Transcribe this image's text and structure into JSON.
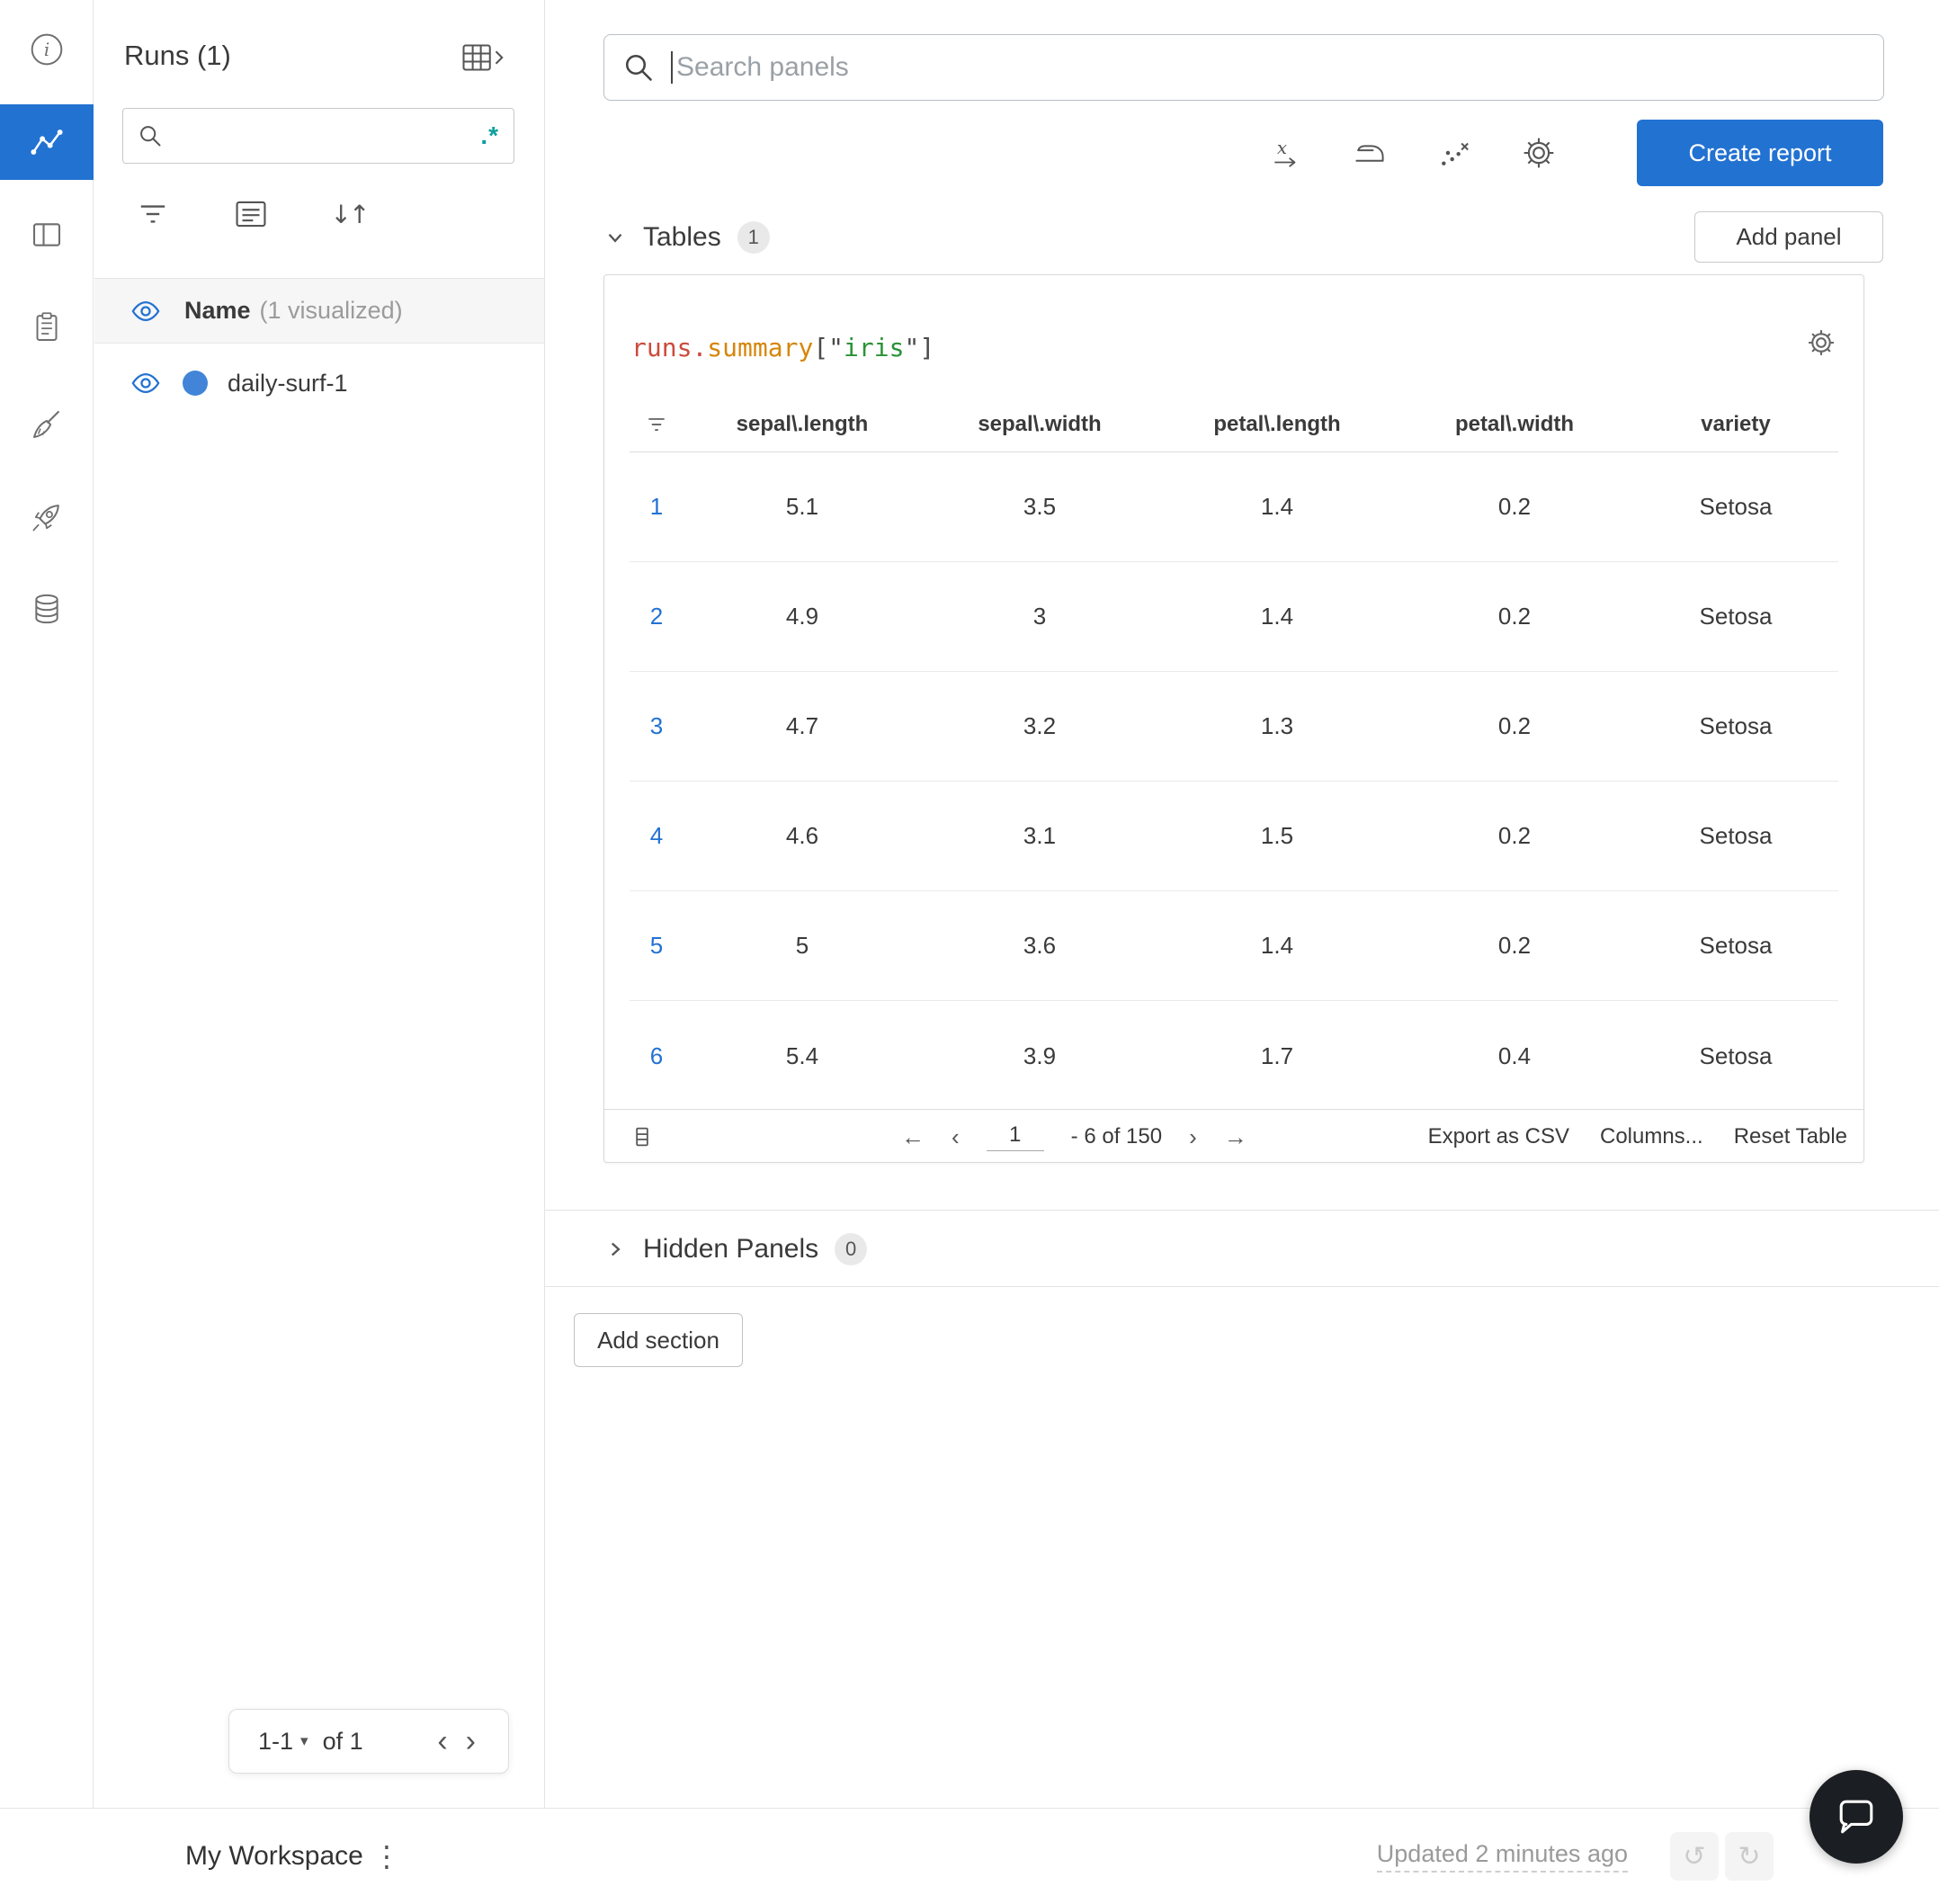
{
  "colors": {
    "accent_blue": "#2272d2",
    "run_dot_blue": "#4285d8",
    "regex_teal": "#0f9f9f",
    "code_red": "#cb4b3c",
    "code_orange": "#d5860b",
    "code_green": "#2a9235",
    "chat_bubble_bg": "#1b1e23"
  },
  "left_rail": {
    "icons": [
      "info-icon",
      "line-chart-icon",
      "panel-layout-icon",
      "clipboard-icon",
      "sweep-icon",
      "rocket-icon",
      "database-icon"
    ],
    "selected": "line-chart-icon"
  },
  "sidebar": {
    "title": "Runs (1)",
    "search_value": "",
    "regex_toggle": ".*",
    "columns_header": {
      "name": "Name",
      "visualized": "(1 visualized)"
    },
    "runs": [
      {
        "name": "daily-surf-1"
      }
    ],
    "pagination": {
      "range": "1-1",
      "caret": "▾",
      "of": "of 1",
      "prev": "‹",
      "next": "›"
    }
  },
  "topbar": {
    "search_placeholder": "Search panels",
    "create_report_label": "Create report"
  },
  "sections": {
    "tables_label": "Tables",
    "tables_count": "1",
    "add_panel_label": "Add panel",
    "hidden_label": "Hidden Panels",
    "hidden_count": "0",
    "add_section_label": "Add section"
  },
  "panel": {
    "code_title": {
      "obj": "runs",
      "dot": ".",
      "prop": "summary",
      "open": "[\"",
      "key": "iris",
      "close": "\"]"
    },
    "table": {
      "headers": [
        "",
        "sepal\\.length",
        "sepal\\.width",
        "petal\\.length",
        "petal\\.width",
        "variety"
      ],
      "rows": [
        [
          "1",
          "5.1",
          "3.5",
          "1.4",
          "0.2",
          "Setosa"
        ],
        [
          "2",
          "4.9",
          "3",
          "1.4",
          "0.2",
          "Setosa"
        ],
        [
          "3",
          "4.7",
          "3.2",
          "1.3",
          "0.2",
          "Setosa"
        ],
        [
          "4",
          "4.6",
          "3.1",
          "1.5",
          "0.2",
          "Setosa"
        ],
        [
          "5",
          "5",
          "3.6",
          "1.4",
          "0.2",
          "Setosa"
        ],
        [
          "6",
          "5.4",
          "3.9",
          "1.7",
          "0.4",
          "Setosa"
        ]
      ],
      "footer": {
        "page": "1",
        "range_label": "- 6 of 150",
        "arrow_left": "←",
        "chev_left": "‹",
        "chev_right": "›",
        "arrow_right": "→",
        "export_label": "Export as CSV",
        "columns_label": "Columns...",
        "reset_label": "Reset Table"
      }
    }
  },
  "bottombar": {
    "workspace_label": "My Workspace",
    "kebab": "⋮",
    "updated_label": "Updated 2 minutes ago",
    "undo": "↺",
    "redo": "↻"
  }
}
